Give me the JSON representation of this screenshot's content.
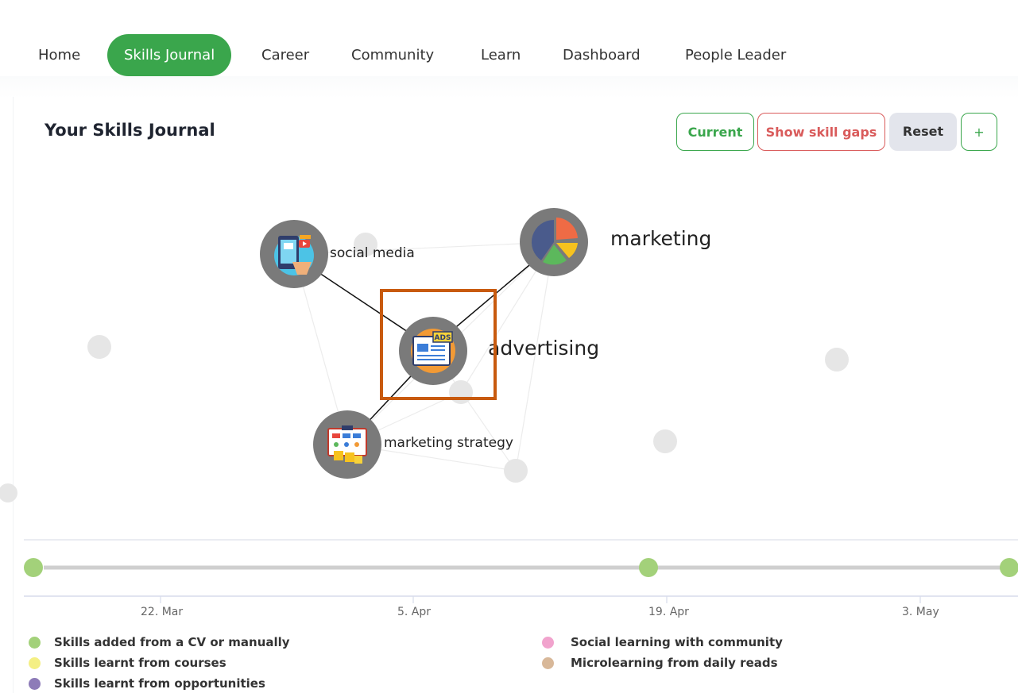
{
  "nav": {
    "items": [
      "Home",
      "Skills Journal",
      "Career",
      "Community",
      "Learn",
      "Dashboard",
      "People Leader"
    ],
    "active": "Skills Journal"
  },
  "page": {
    "title": "Your Skills Journal"
  },
  "toolbar": {
    "current_label": "Current",
    "gaps_label": "Show skill gaps",
    "reset_label": "Reset",
    "add_label": "+"
  },
  "graph": {
    "skills": [
      {
        "name": "social media",
        "icon": "social-media-icon"
      },
      {
        "name": "marketing",
        "icon": "pie-chart-icon"
      },
      {
        "name": "advertising",
        "icon": "ads-newspaper-icon"
      },
      {
        "name": "marketing strategy",
        "icon": "strategy-board-icon"
      }
    ]
  },
  "timeline": {
    "ticks": [
      "22. Mar",
      "5. Apr",
      "19. Apr",
      "3. May"
    ]
  },
  "legend": {
    "items": [
      {
        "label": "Skills added from a CV or manually",
        "color": "#a3d17a"
      },
      {
        "label": "Skills learnt from courses",
        "color": "#f4ef84"
      },
      {
        "label": "Skills learnt from opportunities",
        "color": "#8d7bb8"
      },
      {
        "label": "Social learning with community",
        "color": "#f1a3cd"
      },
      {
        "label": "Microlearning from daily reads",
        "color": "#d8b899"
      }
    ]
  },
  "colors": {
    "accent": "#3aa64c",
    "danger": "#d95b5b",
    "highlight": "#c85a0e",
    "node": "#7a7a7a"
  }
}
